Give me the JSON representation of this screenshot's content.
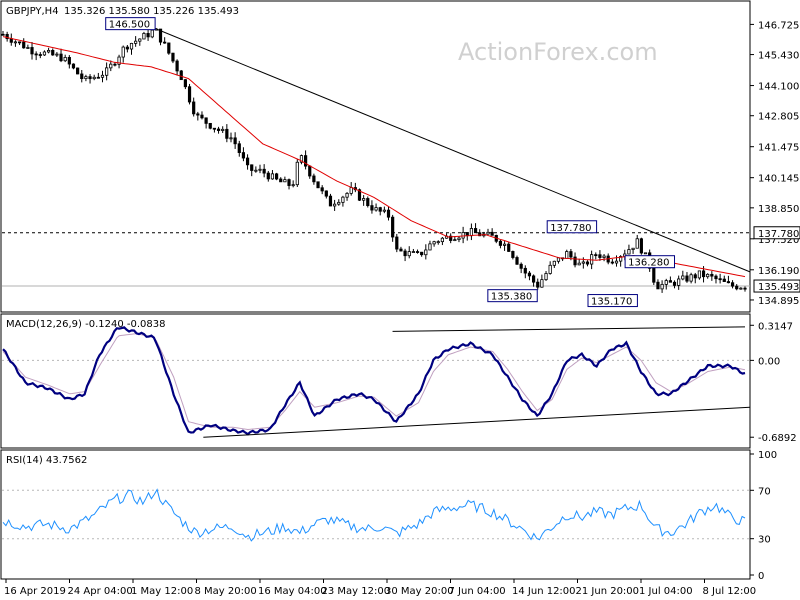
{
  "header": {
    "symbol": "GBPJPY,H4",
    "ohlc": "135.326 135.580 135.226 135.493"
  },
  "watermark": "ActionForex.com",
  "colors": {
    "candle": "#000000",
    "ma": "#e00000",
    "macd": "#000080",
    "signal": "#c0a0c0",
    "rsi": "#1e90ff",
    "grid": "#b8b8b8"
  },
  "chart_data": [
    {
      "type": "candlestick",
      "title": "GBPJPY,H4",
      "y_ticks": [
        "146.725",
        "145.430",
        "144.100",
        "142.805",
        "141.475",
        "140.145",
        "138.850",
        "137.520",
        "136.190",
        "134.895"
      ],
      "ylim": [
        134.55,
        147.0
      ],
      "x_ticks": [
        "16 Apr 2019",
        "24 Apr 04:00",
        "1 May 12:00",
        "8 May 20:00",
        "16 May 04:00",
        "23 May 12:00",
        "30 May 20:00",
        "7 Jun 04:00",
        "14 Jun 12:00",
        "21 Jun 20:00",
        "1 Jul 04:00",
        "8 Jul 12:00"
      ],
      "current_price": "135.493",
      "resistance_line": {
        "value": 137.78,
        "label": "137.780"
      },
      "annotations": [
        {
          "label": "146.500",
          "price": 146.5,
          "x_index": 0.205
        },
        {
          "label": "137.780",
          "price": 137.78,
          "x_index": 0.8
        },
        {
          "label": "136.280",
          "price": 136.28,
          "x_index": 0.905
        },
        {
          "label": "135.380",
          "price": 135.38,
          "x_index": 0.72
        },
        {
          "label": "135.170",
          "price": 135.17,
          "x_index": 0.855
        }
      ],
      "trendline": {
        "from": {
          "x_index": 0.205,
          "price": 146.55
        },
        "to": {
          "x_index": 1.0,
          "price": 136.1
        }
      },
      "price_path": [
        [
          0,
          146.3
        ],
        [
          0.04,
          145.6
        ],
        [
          0.08,
          145.3
        ],
        [
          0.11,
          144.3
        ],
        [
          0.14,
          144.7
        ],
        [
          0.165,
          145.8
        ],
        [
          0.19,
          146.2
        ],
        [
          0.205,
          146.5
        ],
        [
          0.22,
          145.7
        ],
        [
          0.24,
          144.5
        ],
        [
          0.26,
          142.8
        ],
        [
          0.28,
          142.4
        ],
        [
          0.31,
          141.8
        ],
        [
          0.33,
          140.5
        ],
        [
          0.35,
          140.4
        ],
        [
          0.37,
          140.0
        ],
        [
          0.39,
          139.8
        ],
        [
          0.4,
          141.1
        ],
        [
          0.42,
          140.0
        ],
        [
          0.44,
          139.0
        ],
        [
          0.47,
          139.6
        ],
        [
          0.5,
          138.8
        ],
        [
          0.52,
          138.5
        ],
        [
          0.53,
          137.0
        ],
        [
          0.56,
          136.8
        ],
        [
          0.58,
          137.4
        ],
        [
          0.6,
          137.6
        ],
        [
          0.63,
          137.8
        ],
        [
          0.66,
          137.6
        ],
        [
          0.68,
          137.2
        ],
        [
          0.7,
          136.2
        ],
        [
          0.72,
          135.5
        ],
        [
          0.74,
          136.4
        ],
        [
          0.76,
          136.9
        ],
        [
          0.78,
          136.3
        ],
        [
          0.8,
          136.9
        ],
        [
          0.82,
          136.6
        ],
        [
          0.84,
          137.0
        ],
        [
          0.855,
          137.4
        ],
        [
          0.87,
          136.5
        ],
        [
          0.88,
          135.5
        ],
        [
          0.9,
          135.6
        ],
        [
          0.92,
          135.8
        ],
        [
          0.94,
          136.0
        ],
        [
          0.96,
          135.8
        ],
        [
          0.98,
          135.5
        ],
        [
          1.0,
          135.49
        ]
      ],
      "ma_path": [
        [
          0,
          146.2
        ],
        [
          0.1,
          145.5
        ],
        [
          0.15,
          145.1
        ],
        [
          0.2,
          144.9
        ],
        [
          0.25,
          144.4
        ],
        [
          0.3,
          143.0
        ],
        [
          0.35,
          141.6
        ],
        [
          0.4,
          140.9
        ],
        [
          0.45,
          140.0
        ],
        [
          0.5,
          139.3
        ],
        [
          0.55,
          138.3
        ],
        [
          0.6,
          137.6
        ],
        [
          0.65,
          137.7
        ],
        [
          0.7,
          137.2
        ],
        [
          0.75,
          136.7
        ],
        [
          0.8,
          136.6
        ],
        [
          0.85,
          136.8
        ],
        [
          0.9,
          136.5
        ],
        [
          0.95,
          136.2
        ],
        [
          1.0,
          135.9
        ]
      ]
    },
    {
      "type": "line",
      "title": "MACD(12,26,9) -0.1240 -0.0838",
      "y_ticks": [
        "0.3147",
        "0.00",
        "-0.6892"
      ],
      "ylim": [
        -0.75,
        0.38
      ],
      "series": [
        {
          "name": "MACD",
          "values": [
            [
              0,
              0.1
            ],
            [
              0.03,
              -0.2
            ],
            [
              0.06,
              -0.25
            ],
            [
              0.09,
              -0.35
            ],
            [
              0.11,
              -0.3
            ],
            [
              0.13,
              0.05
            ],
            [
              0.155,
              0.3
            ],
            [
              0.18,
              0.25
            ],
            [
              0.205,
              0.2
            ],
            [
              0.23,
              -0.3
            ],
            [
              0.25,
              -0.65
            ],
            [
              0.28,
              -0.58
            ],
            [
              0.31,
              -0.63
            ],
            [
              0.33,
              -0.65
            ],
            [
              0.36,
              -0.62
            ],
            [
              0.38,
              -0.4
            ],
            [
              0.4,
              -0.2
            ],
            [
              0.42,
              -0.5
            ],
            [
              0.45,
              -0.35
            ],
            [
              0.48,
              -0.3
            ],
            [
              0.5,
              -0.35
            ],
            [
              0.53,
              -0.55
            ],
            [
              0.56,
              -0.3
            ],
            [
              0.58,
              0.0
            ],
            [
              0.6,
              0.1
            ],
            [
              0.63,
              0.15
            ],
            [
              0.66,
              0.05
            ],
            [
              0.68,
              -0.15
            ],
            [
              0.7,
              -0.35
            ],
            [
              0.72,
              -0.5
            ],
            [
              0.74,
              -0.3
            ],
            [
              0.76,
              0.0
            ],
            [
              0.78,
              0.05
            ],
            [
              0.8,
              -0.05
            ],
            [
              0.82,
              0.1
            ],
            [
              0.84,
              0.15
            ],
            [
              0.86,
              -0.1
            ],
            [
              0.88,
              -0.3
            ],
            [
              0.9,
              -0.3
            ],
            [
              0.92,
              -0.2
            ],
            [
              0.95,
              -0.05
            ],
            [
              0.98,
              -0.05
            ],
            [
              1.0,
              -0.124
            ]
          ]
        },
        {
          "name": "Signal",
          "values": [
            [
              0,
              0.08
            ],
            [
              0.03,
              -0.15
            ],
            [
              0.06,
              -0.22
            ],
            [
              0.09,
              -0.3
            ],
            [
              0.11,
              -0.28
            ],
            [
              0.13,
              -0.05
            ],
            [
              0.155,
              0.22
            ],
            [
              0.18,
              0.24
            ],
            [
              0.205,
              0.2
            ],
            [
              0.23,
              -0.15
            ],
            [
              0.25,
              -0.55
            ],
            [
              0.28,
              -0.6
            ],
            [
              0.31,
              -0.6
            ],
            [
              0.33,
              -0.62
            ],
            [
              0.36,
              -0.6
            ],
            [
              0.38,
              -0.45
            ],
            [
              0.4,
              -0.28
            ],
            [
              0.42,
              -0.42
            ],
            [
              0.45,
              -0.38
            ],
            [
              0.48,
              -0.32
            ],
            [
              0.5,
              -0.33
            ],
            [
              0.53,
              -0.5
            ],
            [
              0.56,
              -0.38
            ],
            [
              0.58,
              -0.1
            ],
            [
              0.6,
              0.05
            ],
            [
              0.63,
              0.12
            ],
            [
              0.66,
              0.08
            ],
            [
              0.68,
              -0.08
            ],
            [
              0.7,
              -0.28
            ],
            [
              0.72,
              -0.45
            ],
            [
              0.74,
              -0.35
            ],
            [
              0.76,
              -0.08
            ],
            [
              0.78,
              0.02
            ],
            [
              0.8,
              -0.02
            ],
            [
              0.82,
              0.05
            ],
            [
              0.84,
              0.12
            ],
            [
              0.86,
              0.0
            ],
            [
              0.88,
              -0.2
            ],
            [
              0.9,
              -0.28
            ],
            [
              0.92,
              -0.22
            ],
            [
              0.95,
              -0.1
            ],
            [
              0.98,
              -0.06
            ],
            [
              1.0,
              -0.084
            ]
          ]
        }
      ],
      "upper_line": {
        "from": {
          "x_index": 0.525,
          "value": 0.26
        },
        "to": {
          "x_index": 1.0,
          "value": 0.3
        }
      },
      "lower_line": {
        "from": {
          "x_index": 0.27,
          "value": -0.69
        },
        "to": {
          "x_index": 1.04,
          "value": -0.4
        }
      }
    },
    {
      "type": "line",
      "title": "RSI(14) 43.7562",
      "y_ticks": [
        "100",
        "70",
        "30",
        "0"
      ],
      "ylim": [
        0,
        100
      ],
      "reference_levels": [
        70,
        30
      ],
      "series": [
        {
          "name": "RSI",
          "values": [
            [
              0,
              45
            ],
            [
              0.03,
              40
            ],
            [
              0.06,
              42
            ],
            [
              0.09,
              38
            ],
            [
              0.12,
              48
            ],
            [
              0.15,
              62
            ],
            [
              0.17,
              66
            ],
            [
              0.19,
              60
            ],
            [
              0.205,
              70
            ],
            [
              0.22,
              58
            ],
            [
              0.24,
              45
            ],
            [
              0.26,
              35
            ],
            [
              0.28,
              38
            ],
            [
              0.31,
              40
            ],
            [
              0.33,
              32
            ],
            [
              0.36,
              36
            ],
            [
              0.38,
              40
            ],
            [
              0.4,
              35
            ],
            [
              0.42,
              42
            ],
            [
              0.44,
              46
            ],
            [
              0.47,
              40
            ],
            [
              0.49,
              38
            ],
            [
              0.51,
              40
            ],
            [
              0.53,
              34
            ],
            [
              0.56,
              42
            ],
            [
              0.58,
              52
            ],
            [
              0.6,
              55
            ],
            [
              0.63,
              58
            ],
            [
              0.66,
              52
            ],
            [
              0.68,
              45
            ],
            [
              0.7,
              38
            ],
            [
              0.72,
              30
            ],
            [
              0.74,
              40
            ],
            [
              0.76,
              50
            ],
            [
              0.78,
              48
            ],
            [
              0.8,
              52
            ],
            [
              0.82,
              50
            ],
            [
              0.84,
              55
            ],
            [
              0.86,
              58
            ],
            [
              0.88,
              38
            ],
            [
              0.9,
              35
            ],
            [
              0.92,
              42
            ],
            [
              0.94,
              52
            ],
            [
              0.96,
              58
            ],
            [
              0.98,
              48
            ],
            [
              1.0,
              43.76
            ]
          ]
        }
      ]
    }
  ]
}
